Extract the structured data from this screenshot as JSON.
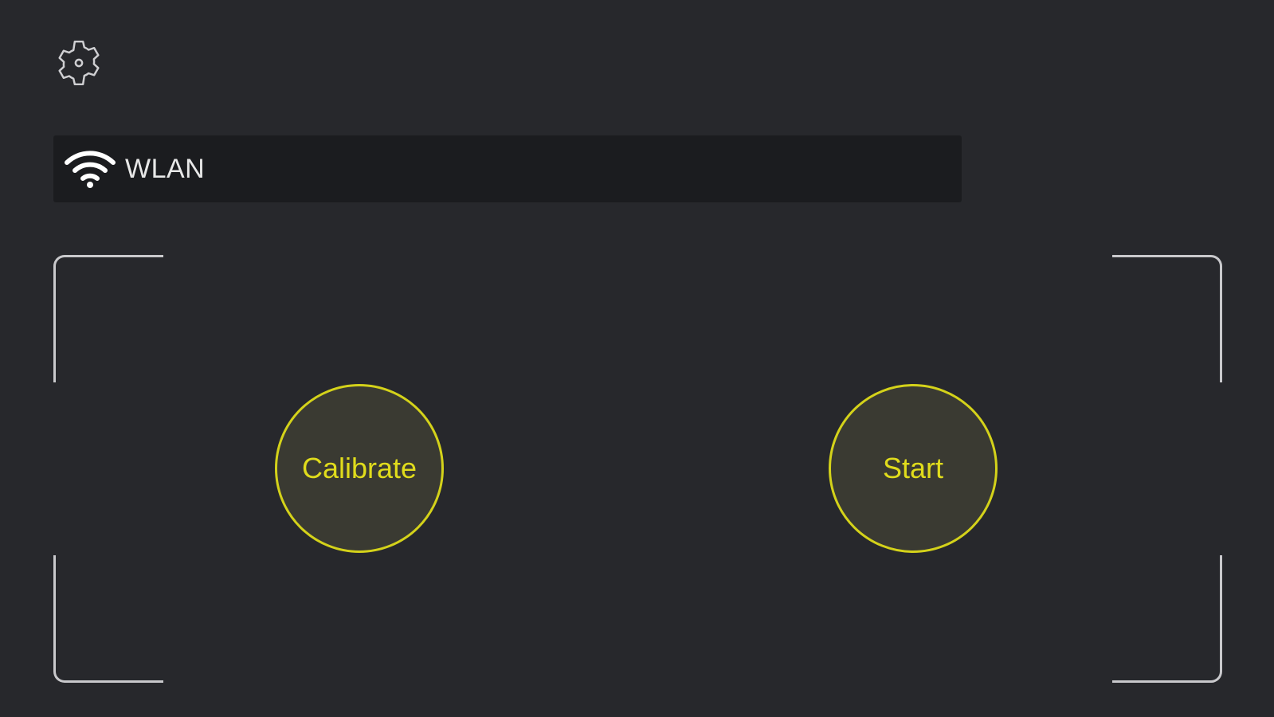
{
  "header": {
    "settings_icon": "gear-icon"
  },
  "network": {
    "icon": "wifi-icon",
    "label": "WLAN"
  },
  "controls": {
    "calibrate_label": "Calibrate",
    "start_label": "Start"
  },
  "colors": {
    "background": "#27282c",
    "bar_background": "#1b1c1f",
    "accent": "#d4d21a",
    "frame": "#c9c9cc"
  }
}
